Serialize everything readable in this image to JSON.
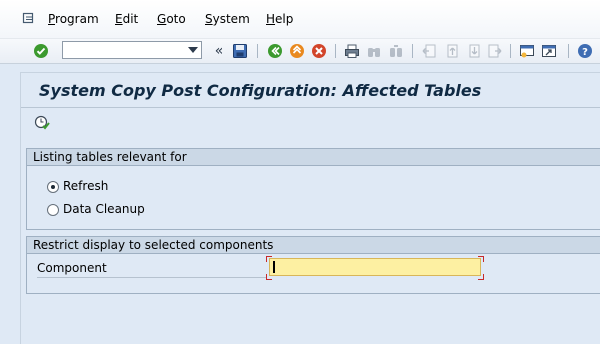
{
  "menubar": {
    "items": [
      {
        "label": "Program",
        "underline": "P",
        "rest": "rogram"
      },
      {
        "label": "Edit",
        "underline": "E",
        "rest": "dit"
      },
      {
        "label": "Goto",
        "underline": "G",
        "rest": "oto"
      },
      {
        "label": "System",
        "underline": "S",
        "rest": "ystem"
      },
      {
        "label": "Help",
        "underline": "H",
        "rest": "elp"
      }
    ]
  },
  "toolbar": {
    "command_field_value": "",
    "collapse_glyph": "«",
    "icons": [
      "enter-check-icon",
      "save-icon",
      "back-icon",
      "exit-icon",
      "cancel-icon",
      "print-icon",
      "find-icon",
      "find-next-icon",
      "first-page-icon",
      "previous-page-icon",
      "next-page-icon",
      "last-page-icon",
      "create-session-icon",
      "shortcut-icon",
      "help-icon"
    ]
  },
  "title": "System Copy Post Configuration: Affected Tables",
  "groups": {
    "listing": {
      "title": "Listing tables relevant for",
      "options": [
        {
          "label": "Refresh",
          "selected": true
        },
        {
          "label": "Data Cleanup",
          "selected": false
        }
      ]
    },
    "restrict": {
      "title": "Restrict display to selected components",
      "field_label": "Component",
      "field_value": ""
    }
  },
  "colors": {
    "accent_green": "#3c9a2f",
    "accent_orange": "#e9891f",
    "accent_red": "#d2452b",
    "input_yellow": "#fdf0a2"
  }
}
